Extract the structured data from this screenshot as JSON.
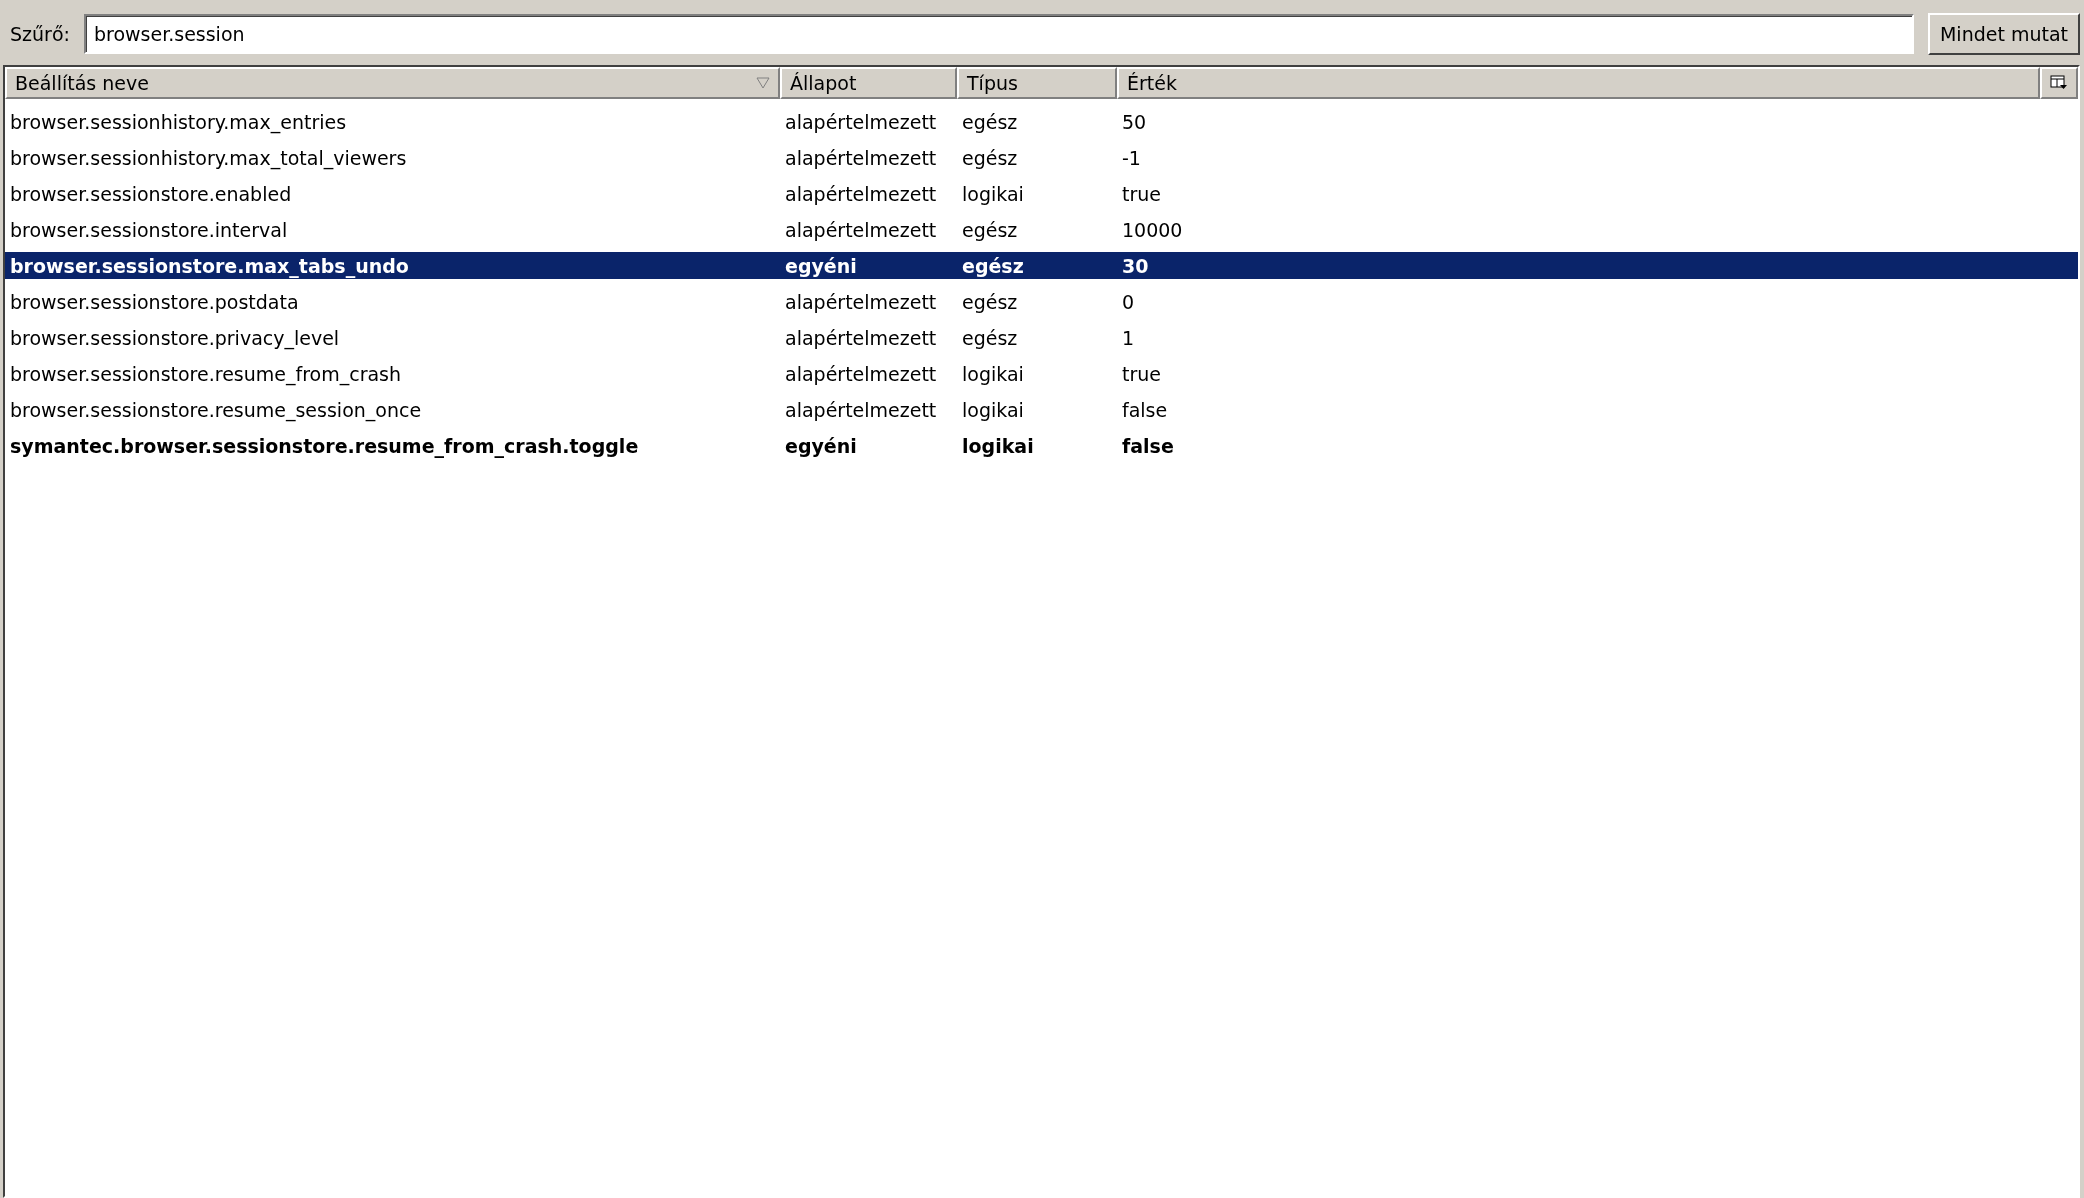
{
  "filter": {
    "label": "Szűrő:",
    "value": "browser.session"
  },
  "show_all_button": "Mindet mutat",
  "table": {
    "columns": [
      {
        "label": "Beállítás neve",
        "sorted": true
      },
      {
        "label": "Állapot",
        "sorted": false
      },
      {
        "label": "Típus",
        "sorted": false
      },
      {
        "label": "Érték",
        "sorted": false
      }
    ],
    "rows": [
      {
        "name": "browser.sessionhistory.max_entries",
        "status": "alapértelmezett",
        "type": "egész",
        "value": "50",
        "modified": false,
        "selected": false
      },
      {
        "name": "browser.sessionhistory.max_total_viewers",
        "status": "alapértelmezett",
        "type": "egész",
        "value": "-1",
        "modified": false,
        "selected": false
      },
      {
        "name": "browser.sessionstore.enabled",
        "status": "alapértelmezett",
        "type": "logikai",
        "value": "true",
        "modified": false,
        "selected": false
      },
      {
        "name": "browser.sessionstore.interval",
        "status": "alapértelmezett",
        "type": "egész",
        "value": "10000",
        "modified": false,
        "selected": false
      },
      {
        "name": "browser.sessionstore.max_tabs_undo",
        "status": "egyéni",
        "type": "egész",
        "value": "30",
        "modified": true,
        "selected": true
      },
      {
        "name": "browser.sessionstore.postdata",
        "status": "alapértelmezett",
        "type": "egész",
        "value": "0",
        "modified": false,
        "selected": false
      },
      {
        "name": "browser.sessionstore.privacy_level",
        "status": "alapértelmezett",
        "type": "egész",
        "value": "1",
        "modified": false,
        "selected": false
      },
      {
        "name": "browser.sessionstore.resume_from_crash",
        "status": "alapértelmezett",
        "type": "logikai",
        "value": "true",
        "modified": false,
        "selected": false
      },
      {
        "name": "browser.sessionstore.resume_session_once",
        "status": "alapértelmezett",
        "type": "logikai",
        "value": "false",
        "modified": false,
        "selected": false
      },
      {
        "name": "symantec.browser.sessionstore.resume_from_crash.toggle",
        "status": "egyéni",
        "type": "logikai",
        "value": "false",
        "modified": true,
        "selected": false
      }
    ]
  }
}
